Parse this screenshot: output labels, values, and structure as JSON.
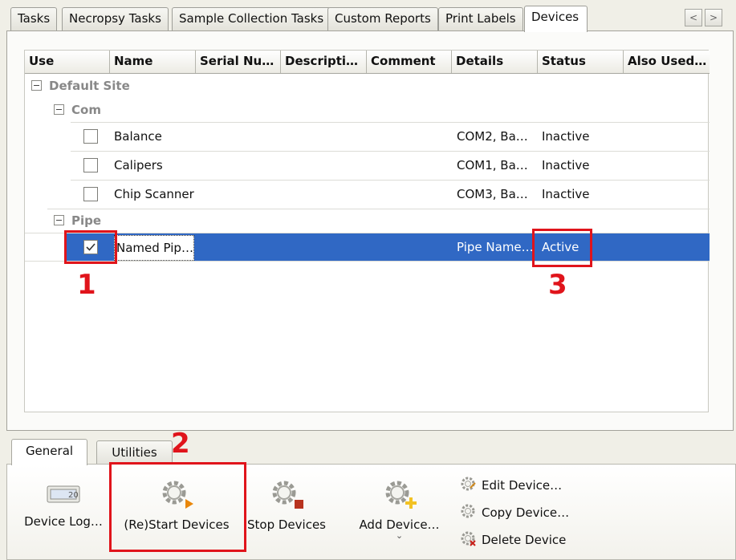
{
  "top_tabs": [
    "Tasks",
    "Necropsy Tasks",
    "Sample Collection Tasks",
    "Custom Reports",
    "Print Labels",
    "Devices"
  ],
  "active_top_tab": "Devices",
  "nav": {
    "prev": "<",
    "next": ">"
  },
  "columns": [
    "Use",
    "Name",
    "Serial Nu…",
    "Descripti…",
    "Comment",
    "Details",
    "Status",
    "Also Used…"
  ],
  "site_group": "Default Site",
  "groups": [
    {
      "name": "Com",
      "rows": [
        {
          "use": false,
          "name": "Balance",
          "details": "COM2, Ba…",
          "status": "Inactive"
        },
        {
          "use": false,
          "name": "Calipers",
          "details": "COM1, Ba…",
          "status": "Inactive"
        },
        {
          "use": false,
          "name": "Chip Scanner",
          "details": "COM3, Ba…",
          "status": "Inactive"
        }
      ]
    },
    {
      "name": "Pipe",
      "rows": [
        {
          "use": true,
          "name": "Named Pip…",
          "details": "Pipe Name…",
          "status": "Active",
          "selected": true
        }
      ]
    }
  ],
  "callouts": [
    "1",
    "2",
    "3"
  ],
  "ribbon_tabs": [
    "General",
    "Utilities"
  ],
  "ribbon": {
    "device_log": "Device Log…",
    "device_log_icon_text": "20",
    "restart": "(Re)Start Devices",
    "stop": "Stop Devices",
    "add": "Add Device…",
    "add_caret": "⌄",
    "edit": "Edit Device…",
    "copy": "Copy Device…",
    "delete": "Delete Device"
  },
  "colors": {
    "selection": "#3068c4",
    "callout": "#e0141b",
    "active_text": "#ffffff"
  }
}
